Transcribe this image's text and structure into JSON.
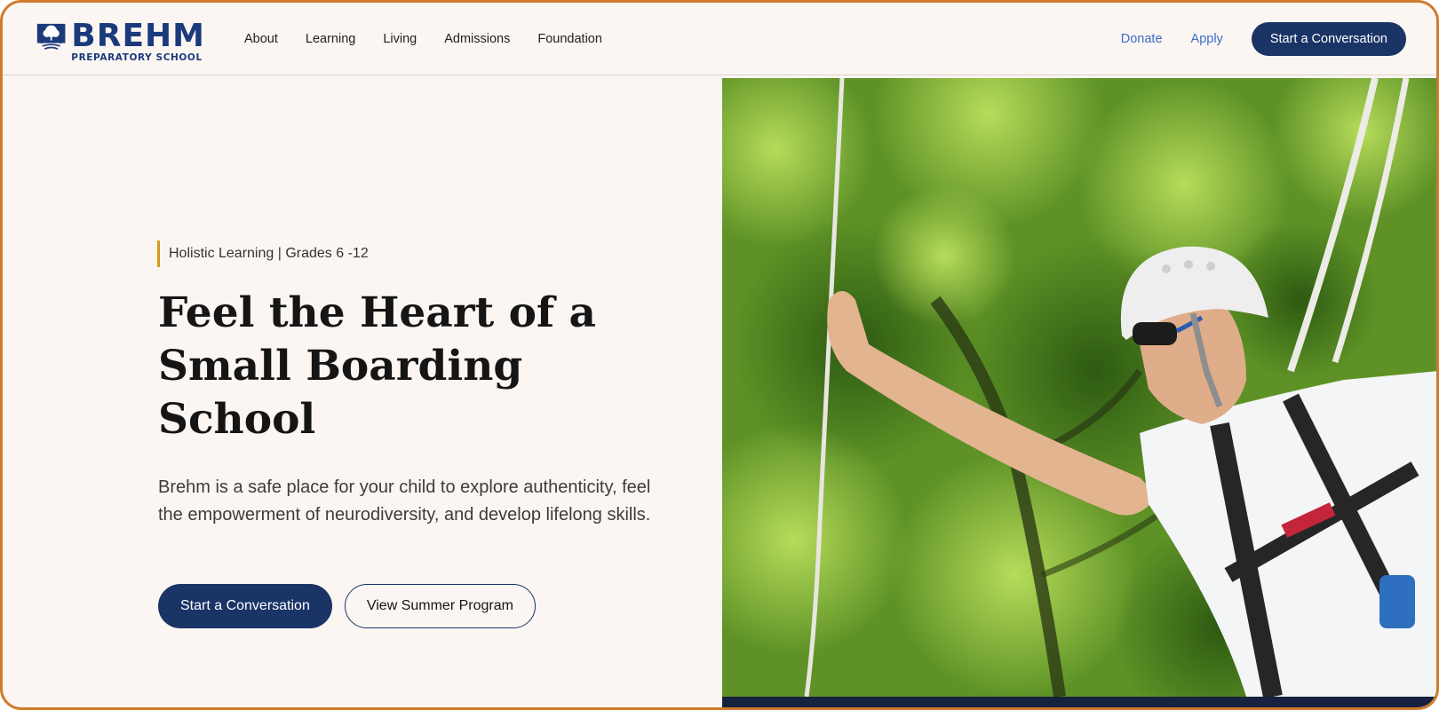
{
  "header": {
    "logo": {
      "name": "BREHM",
      "subtitle": "PREPARATORY SCHOOL"
    },
    "nav": [
      {
        "label": "About"
      },
      {
        "label": "Learning"
      },
      {
        "label": "Living"
      },
      {
        "label": "Admissions"
      },
      {
        "label": "Foundation"
      }
    ],
    "right_links": {
      "donate": "Donate",
      "apply": "Apply",
      "cta": "Start a Conversation"
    }
  },
  "hero": {
    "eyebrow": "Holistic Learning | Grades 6 -12",
    "headline": "Feel the Heart of a Small Boarding School",
    "body": "Brehm is a safe place for your child to explore authenticity, feel the empowerment of neurodiversity, and develop lifelong skills.",
    "primary_button": "Start a Conversation",
    "secondary_button": "View Summer Program",
    "image_icon": "climber-photo"
  },
  "colors": {
    "brand_navy": "#1a3466",
    "logo_blue": "#1b3a7c",
    "link_blue": "#3a6cc9",
    "accent_gold": "#d49a1c",
    "background": "#fcf6f3",
    "frame_orange": "#d27a2c"
  }
}
